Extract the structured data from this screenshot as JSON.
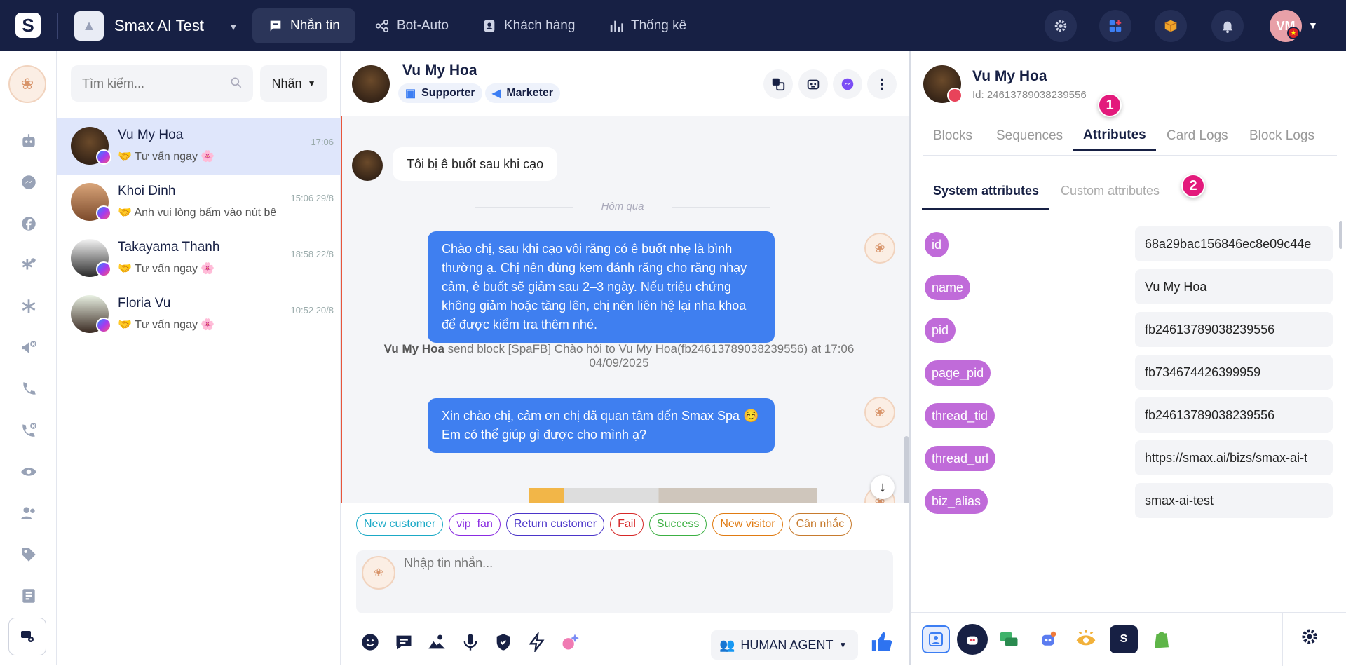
{
  "topbar": {
    "logo": "S",
    "biz_name": "Smax AI Test",
    "nav": [
      {
        "label": "Nhắn tin",
        "icon": "chat-icon",
        "active": true
      },
      {
        "label": "Bot-Auto",
        "icon": "bot-icon",
        "active": false
      },
      {
        "label": "Khách hàng",
        "icon": "contact-icon",
        "active": false
      },
      {
        "label": "Thống kê",
        "icon": "stats-icon",
        "active": false
      }
    ],
    "avatar_initials": "VM"
  },
  "conversations": {
    "search_placeholder": "Tìm kiếm...",
    "label_button": "Nhãn",
    "items": [
      {
        "name": "Vu My Hoa",
        "preview": "🤝 Tư vấn ngay 🌸",
        "time": "17:06"
      },
      {
        "name": "Khoi Dinh",
        "preview": "🤝 Anh vui lòng bấm vào nút bê",
        "time": "15:06 29/8"
      },
      {
        "name": "Takayama Thanh",
        "preview": "🤝 Tư vấn ngay 🌸",
        "time": "18:58 22/8"
      },
      {
        "name": "Floria Vu",
        "preview": "🤝 Tư vấn ngay 🌸",
        "time": "10:52 20/8"
      }
    ]
  },
  "chat": {
    "name": "Vu My Hoa",
    "tags": [
      "Supporter",
      "Marketer"
    ],
    "messages": {
      "incoming": "Tôi bị ê buốt sau khi cạo",
      "day_separator": "Hôm qua",
      "outgoing1": "Chào chị, sau khi cạo vôi răng có ê buốt nhẹ là bình thường ạ. Chị nên dùng kem đánh răng cho răng nhạy cảm, ê buốt sẽ giảm sau 2–3 ngày. Nếu triệu chứng không giảm hoặc tăng lên, chị nên liên hệ lại nha khoa để được kiểm tra thêm nhé.",
      "system_sender": "Vu My Hoa",
      "system_text": "send block [SpaFB] Chào hỏi to Vu My Hoa(fb24613789038239556) at 17:06 04/09/2025",
      "outgoing2": "Xin chào chị, cảm ơn chị đã quan tâm đến Smax Spa ☺️ Em có thể giúp gì được cho mình ạ?"
    },
    "quick_tags": [
      {
        "label": "New customer",
        "color": "#1ba9c6"
      },
      {
        "label": "vip_fan",
        "color": "#8a2be2"
      },
      {
        "label": "Return customer",
        "color": "#4b35c9"
      },
      {
        "label": "Fail",
        "color": "#d62828"
      },
      {
        "label": "Success",
        "color": "#3cb043"
      },
      {
        "label": "New visitor",
        "color": "#e07b12"
      },
      {
        "label": "Cân nhắc",
        "color": "#c77b2e"
      }
    ],
    "composer_placeholder": "Nhập tin nhắn...",
    "agent_mode": "HUMAN AGENT"
  },
  "profile": {
    "name": "Vu My Hoa",
    "id_text": "Id: 24613789038239556",
    "tabs": [
      "Blocks",
      "Sequences",
      "Attributes",
      "Card Logs",
      "Block Logs"
    ],
    "active_tab": "Attributes",
    "sub_tabs": [
      "System attributes",
      "Custom attributes"
    ],
    "badges": [
      "1",
      "2"
    ],
    "attributes": [
      {
        "key": "id",
        "value": "68a29bac156846ec8e09c44e"
      },
      {
        "key": "name",
        "value": "Vu My Hoa"
      },
      {
        "key": "pid",
        "value": "fb24613789038239556"
      },
      {
        "key": "page_pid",
        "value": "fb734674426399959"
      },
      {
        "key": "thread_tid",
        "value": "fb24613789038239556"
      },
      {
        "key": "thread_url",
        "value": "https://smax.ai/bizs/smax-ai-t"
      },
      {
        "key": "biz_alias",
        "value": "smax-ai-test"
      }
    ]
  },
  "colors": {
    "topbar": "#172044",
    "bubble": "#3f7ff0",
    "attr_key": "#c06bd9",
    "badge": "#e31a7c"
  }
}
